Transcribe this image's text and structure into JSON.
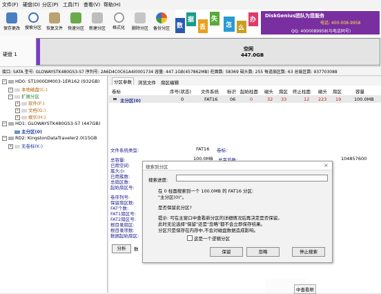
{
  "menu": [
    "文件(F)",
    "硬盘(D)",
    "分区(P)",
    "工具(T)",
    "查看(V)",
    "帮助(H)"
  ],
  "toolbar": [
    {
      "label": "保存更改",
      "icon": "save-icon",
      "color": "#4a7fc1"
    },
    {
      "label": "搜索分区",
      "icon": "search-icon",
      "color": "#3a6fb0"
    },
    {
      "label": "恢复文件",
      "icon": "recover-file-icon",
      "color": "#8a7a5a"
    },
    {
      "label": "快速分区",
      "icon": "quick-partition-icon",
      "color": "#5a9a3a"
    },
    {
      "label": "新建分区",
      "icon": "new-partition-icon",
      "color": "#888888"
    },
    {
      "label": "格式化",
      "icon": "format-icon",
      "color": "#999999"
    },
    {
      "label": "删除分区",
      "icon": "delete-partition-icon",
      "color": "#a0a0a0"
    },
    {
      "label": "备份分区",
      "icon": "backup-partition-icon",
      "color": "#e05a2a"
    }
  ],
  "banner": {
    "letters": [
      "数",
      "据",
      "丢",
      "失",
      "怎",
      "么",
      "办"
    ],
    "brand": "DiskGenius团队为您服务",
    "phone": "电话: 400-008-9958",
    "qq": "QQ: 4000089958(与电话同号)"
  },
  "disk_bar": {
    "label": "硬盘 1",
    "part_label": "空闲",
    "part_size": "447.0GB"
  },
  "info_line": "接口: SATA  型号: GLOWAYSTK480GS3-S7  序列号: 2A6D4C0C61A4I0001734  容量: 447.1GB(457862MB)  柱面数: 58369  磁头数: 255  每道扇区数: 63  总扇区数: 937703088",
  "tree": [
    {
      "text": "HD0: ST1000DM003-1ER162 (932GB)",
      "level": 0,
      "type": "disk"
    },
    {
      "text": "本地磁盘(C:)",
      "level": 1,
      "type": "part"
    },
    {
      "text": "扩展分区",
      "level": 1,
      "type": "ext"
    },
    {
      "text": "软件(F:)",
      "level": 2,
      "type": "part"
    },
    {
      "text": "文档(G:)",
      "level": 2,
      "type": "part"
    },
    {
      "text": "娱乐(H:)",
      "level": 2,
      "type": "part"
    },
    {
      "text": "HD1: GLOWAYSTK480GS3-S7 (447GB)",
      "level": 0,
      "type": "disk"
    },
    {
      "text": "主分区(0)",
      "level": 1,
      "type": "sel"
    },
    {
      "text": "RD2: KingstonDataTraveler2.0(15GB",
      "level": 0,
      "type": "disk"
    },
    {
      "text": "无卷标(K:)",
      "level": 1,
      "type": "part"
    }
  ],
  "tabs": [
    "分区参数",
    "浏览文件",
    "扇区编辑"
  ],
  "grid": {
    "headers": [
      "卷标",
      "序号(状态)",
      "文件系统",
      "标识",
      "起始柱面",
      "磁头",
      "扇区",
      "终止柱面",
      "磁头",
      "扇区",
      "容量"
    ],
    "row": [
      "主分区(0)",
      "0",
      "FAT16",
      "06",
      "0",
      "32",
      "33",
      "12",
      "223",
      "19",
      "100.0MB"
    ]
  },
  "details": {
    "fs_type_label": "文件系统类型:",
    "fs_type_value": "FAT16",
    "vol_label": "卷标:",
    "rows": [
      "总容量:",
      "已用空间:",
      "簇大小:",
      "已用簇数:",
      "总扇区数:",
      "起始扇区号:",
      "",
      "卷序列号:",
      "保留扇区数:",
      "FAT个数:",
      "FAT1扇区号:",
      "FAT2扇区号:",
      "根目录扇区:",
      "根目录项数:",
      "数据起始扇区:"
    ],
    "total_value": "100.0MB",
    "total_bytes_label": "总字节数:",
    "total_bytes_value": "104857600",
    "analyze": "分析",
    "data_label": "数",
    "hint": "中查看帮"
  },
  "dialog": {
    "title": "搜索到分区",
    "progress_label": "搜索进度:",
    "msg1": "在 0 柱面搜索到一个 100.0MB 的 FAT16 分区:",
    "msg2": "\"主分区(0)\"。",
    "question": "是否保留此分区?",
    "tip1": "提示: 可在主窗口中查看新分区的详细情况后再决定是否保留。",
    "tip2": "此时无论选择\"保留\"还是\"忽略\"都不会立即保存结果。",
    "tip3": "分区只是保存在内存中,不会对磁盘数据造成影响。",
    "checkbox": "这是一个逻辑分区",
    "keep": "保留",
    "ignore": "忽略",
    "stop": "停止搜索"
  }
}
